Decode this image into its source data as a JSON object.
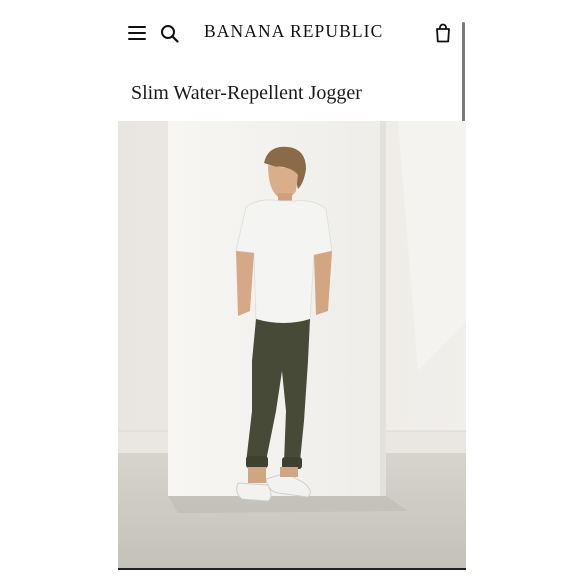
{
  "header": {
    "brand": "BANANA REPUBLIC",
    "menu_icon": "hamburger-menu-icon",
    "search_icon": "search-icon",
    "bag_icon": "shopping-bag-icon"
  },
  "product": {
    "title": "Slim Water-Repellent Jogger"
  },
  "colors": {
    "text": "#111111",
    "wall": "#eeebe6",
    "panel": "#f7f5f2",
    "floor": "#cfcbc5",
    "jogger": "#474a36",
    "shirt": "#f4f4f2"
  }
}
